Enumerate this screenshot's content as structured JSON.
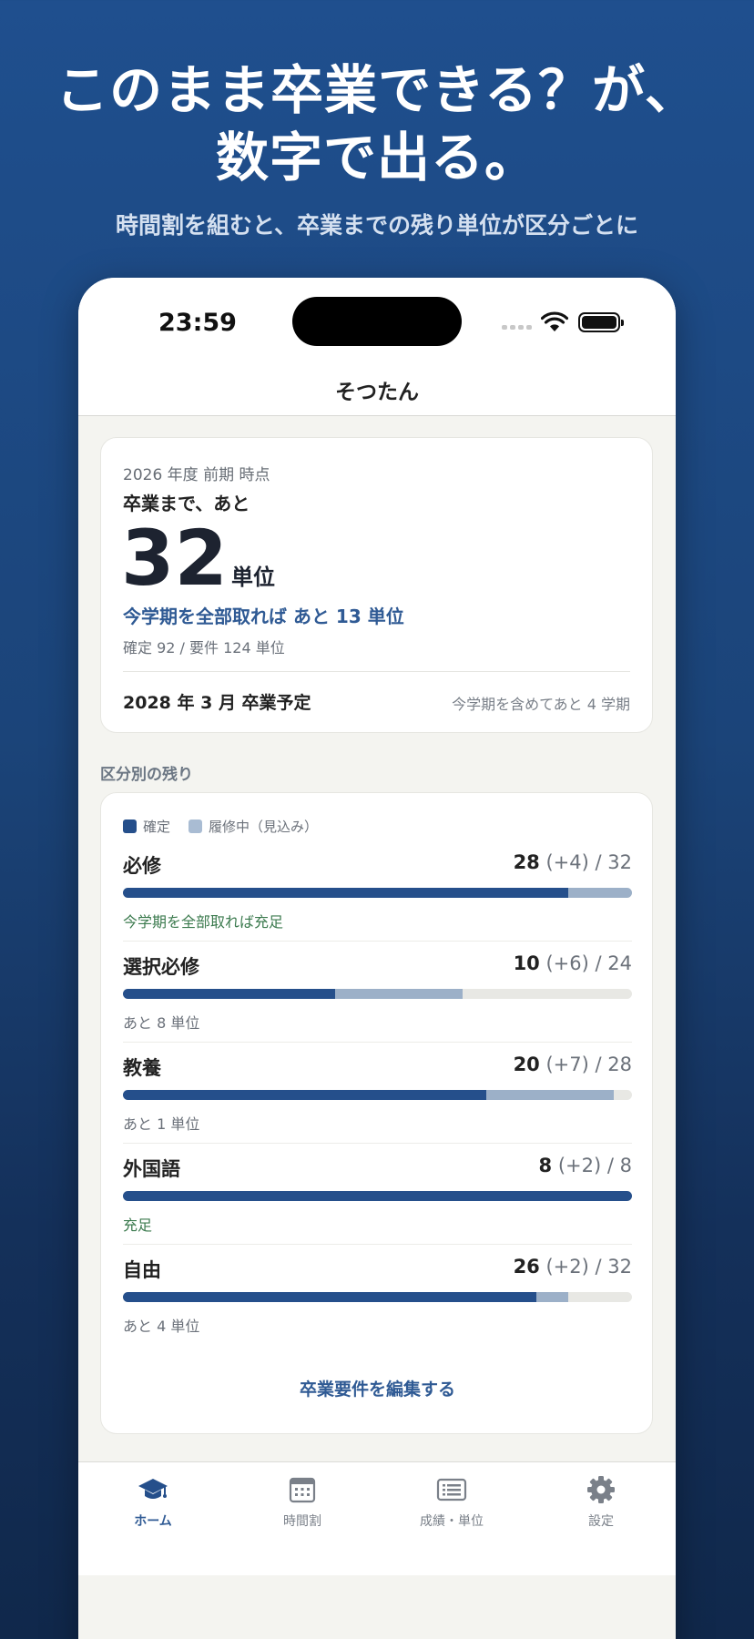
{
  "hero": {
    "title_line1": "このまま卒業できる？が、",
    "title_line2": "数字で出る。",
    "subtitle": "時間割を組むと、卒業までの残り単位が区分ごとに"
  },
  "status_bar": {
    "time": "23:59"
  },
  "nav": {
    "title": "そつたん"
  },
  "summary": {
    "term": "2026 年度 前期 時点",
    "lead": "卒業まで、あと",
    "remaining_credits": "32",
    "unit": "単位",
    "if_all_taken": "今学期を全部取れば あと 13 単位",
    "detail": "確定 92 / 要件 124 単位",
    "graduation": "2028 年 3 月 卒業予定",
    "terms_remaining": "今学期を含めてあと 4 学期"
  },
  "breakdown": {
    "section_label": "区分別の残り",
    "legend_confirmed": "確定",
    "legend_in_progress": "履修中（見込み）",
    "rows": [
      {
        "name": "必修",
        "confirmed": "28",
        "in_progress": "(+4)",
        "required": "/ 32",
        "confirmed_num": 28,
        "in_progress_num": 4,
        "required_num": 32,
        "note": "今学期を全部取れば充足",
        "note_ok": true
      },
      {
        "name": "選択必修",
        "confirmed": "10",
        "in_progress": "(+6)",
        "required": "/ 24",
        "confirmed_num": 10,
        "in_progress_num": 6,
        "required_num": 24,
        "note": "あと 8 単位",
        "note_ok": false
      },
      {
        "name": "教養",
        "confirmed": "20",
        "in_progress": "(+7)",
        "required": "/ 28",
        "confirmed_num": 20,
        "in_progress_num": 7,
        "required_num": 28,
        "note": "あと 1 単位",
        "note_ok": false
      },
      {
        "name": "外国語",
        "confirmed": "8",
        "in_progress": "(+2)",
        "required": "/ 8",
        "confirmed_num": 8,
        "in_progress_num": 2,
        "required_num": 8,
        "note": "充足",
        "note_ok": true
      },
      {
        "name": "自由",
        "confirmed": "26",
        "in_progress": "(+2)",
        "required": "/ 32",
        "confirmed_num": 26,
        "in_progress_num": 2,
        "required_num": 32,
        "note": "あと 4 単位",
        "note_ok": false
      }
    ],
    "edit_link": "卒業要件を編集する"
  },
  "tabs": [
    {
      "label": "ホーム",
      "icon": "graduation-cap-icon",
      "active": true
    },
    {
      "label": "時間割",
      "icon": "calendar-icon",
      "active": false
    },
    {
      "label": "成績・単位",
      "icon": "list-icon",
      "active": false
    },
    {
      "label": "設定",
      "icon": "gear-icon",
      "active": false
    }
  ],
  "colors": {
    "accent": "#2f5a94",
    "confirmed_bar": "#254f8b",
    "in_progress_bar": "#9cb0c8",
    "ok_text": "#3b7a4e"
  }
}
